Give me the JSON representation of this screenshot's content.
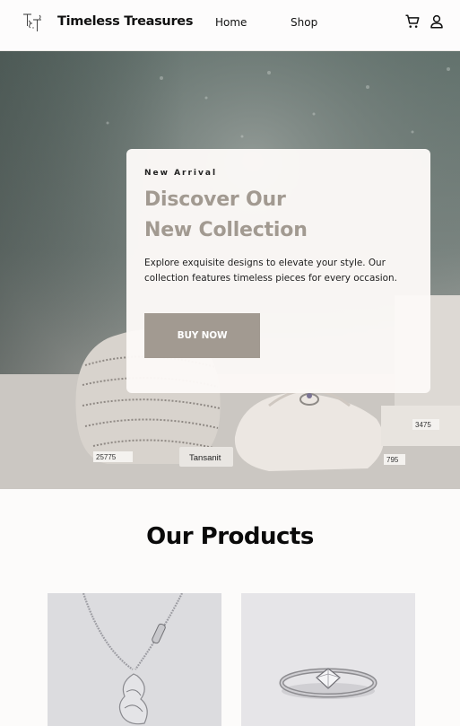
{
  "brand": {
    "name": "Timeless Treasures",
    "logo_letters": "T T"
  },
  "nav": {
    "home": "Home",
    "shop": "Shop"
  },
  "icons": {
    "cart": "cart-icon",
    "user": "user-icon"
  },
  "hero": {
    "eyebrow": "New Arrival",
    "title_line1": "Discover Our",
    "title_line2": "New Collection",
    "description": "Explore exquisite designs to elevate your style. Our collection features timeless pieces for every occasion.",
    "cta": "BUY NOW",
    "photo_tags": [
      "25775",
      "Tansanit",
      "3475",
      "795"
    ]
  },
  "products": {
    "heading": "Our Products",
    "items": [
      {
        "image": "silver dragon pendant necklace"
      },
      {
        "image": "silver solitaire diamond ring"
      }
    ]
  },
  "colors": {
    "accent": "#a29a91",
    "background": "#fcfbfa",
    "text": "#111111"
  }
}
